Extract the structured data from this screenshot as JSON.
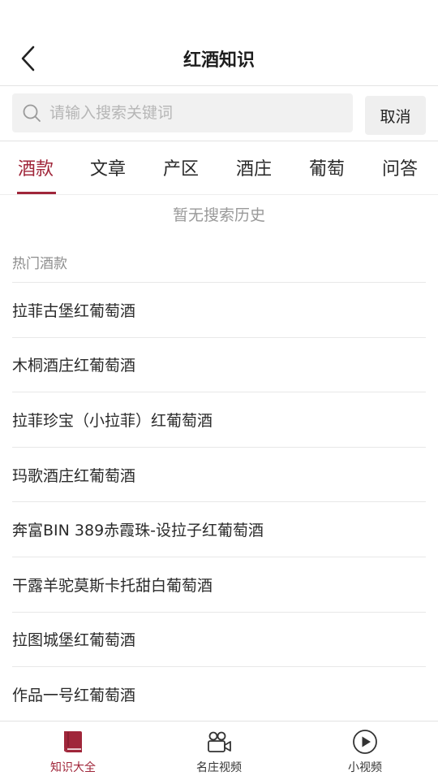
{
  "header": {
    "title": "红酒知识"
  },
  "search": {
    "placeholder": "请输入搜索关键词",
    "value": "",
    "cancel_label": "取消"
  },
  "tabs": [
    {
      "label": "酒款",
      "active": true
    },
    {
      "label": "文章",
      "active": false
    },
    {
      "label": "产区",
      "active": false
    },
    {
      "label": "酒庄",
      "active": false
    },
    {
      "label": "葡萄",
      "active": false
    },
    {
      "label": "问答",
      "active": false
    }
  ],
  "history": {
    "empty_text": "暂无搜索历史"
  },
  "hot": {
    "label": "热门酒款",
    "items": [
      "拉菲古堡红葡萄酒",
      "木桐酒庄红葡萄酒",
      "拉菲珍宝（小拉菲）红葡萄酒",
      "玛歌酒庄红葡萄酒",
      "奔富BIN 389赤霞珠-设拉子红葡萄酒",
      "干露羊驼莫斯卡托甜白葡萄酒",
      "拉图城堡红葡萄酒",
      "作品一号红葡萄酒"
    ]
  },
  "bottom_nav": [
    {
      "label": "知识大全",
      "icon": "book-icon",
      "active": true
    },
    {
      "label": "名庄视频",
      "icon": "video-camera-icon",
      "active": false
    },
    {
      "label": "小视频",
      "icon": "play-circle-icon",
      "active": false
    }
  ],
  "colors": {
    "accent": "#a0263a",
    "text": "#2a2a2a",
    "muted": "#999999",
    "divider": "#e8e8e8"
  }
}
